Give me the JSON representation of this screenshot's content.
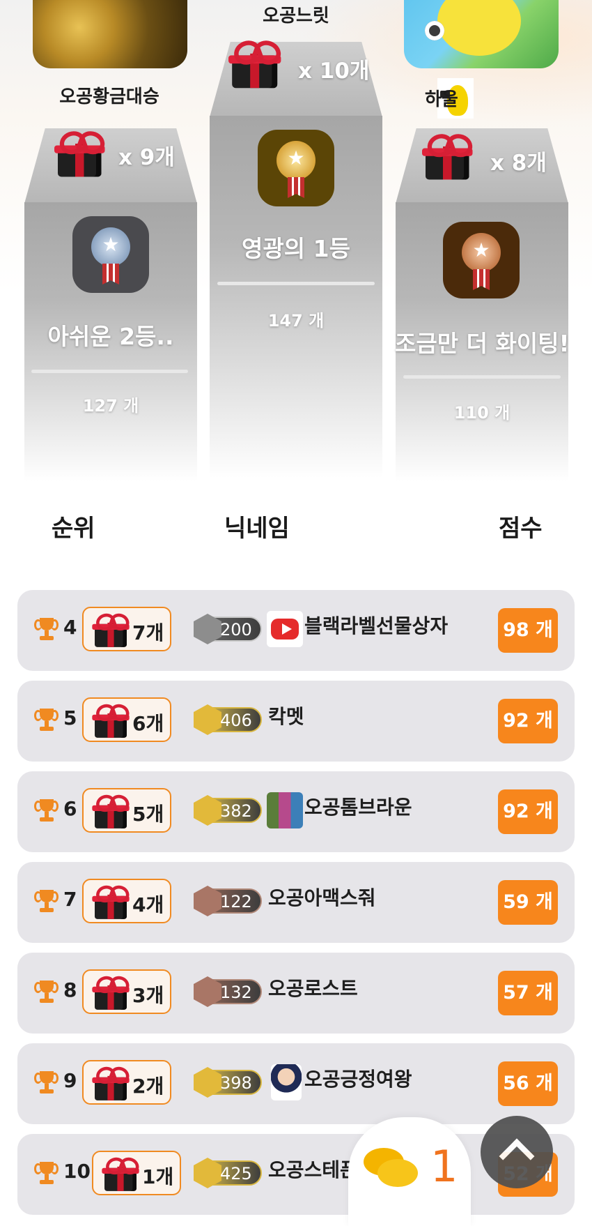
{
  "podium": {
    "first": {
      "name": "오공느릿",
      "gift_count": "x 10개",
      "title": "영광의 1등",
      "score": "147 개"
    },
    "second": {
      "name": "오공황금대승",
      "gift_count": "x 9개",
      "title": "아쉬운 2등..",
      "score": "127 개"
    },
    "third": {
      "name": "하울",
      "gift_count": "x 8개",
      "title": "조금만 더 화이팅!",
      "score": "110 개"
    }
  },
  "headers": {
    "rank": "순위",
    "nickname": "닉네임",
    "score": "점수"
  },
  "rows": [
    {
      "rank": "4",
      "gifts": "7개",
      "level": "200",
      "nickname": "블랙라벨선물상자",
      "score": "98 개"
    },
    {
      "rank": "5",
      "gifts": "6개",
      "level": "406",
      "nickname": "칵멧",
      "score": "92 개"
    },
    {
      "rank": "6",
      "gifts": "5개",
      "level": "382",
      "nickname": "오공톰브라운",
      "score": "92 개"
    },
    {
      "rank": "7",
      "gifts": "4개",
      "level": "122",
      "nickname": "오공아맥스줘",
      "score": "59 개"
    },
    {
      "rank": "8",
      "gifts": "3개",
      "level": "132",
      "nickname": "오공로스트",
      "score": "57 개"
    },
    {
      "rank": "9",
      "gifts": "2개",
      "level": "398",
      "nickname": "오공긍정여왕",
      "score": "56 개"
    },
    {
      "rank": "10",
      "gifts": "1개",
      "level": "425",
      "nickname": "오공스테픈커",
      "score": "52 개"
    }
  ],
  "chat": {
    "count": "1"
  },
  "colors": {
    "accent": "#f7861c",
    "row_bg": "#e6e5e9",
    "podium_gray": "#b6b6b6"
  },
  "icons": [
    "gift-icon",
    "medal-icon",
    "trophy-icon",
    "level-badge-icon",
    "chat-icon",
    "chevron-up-icon"
  ]
}
